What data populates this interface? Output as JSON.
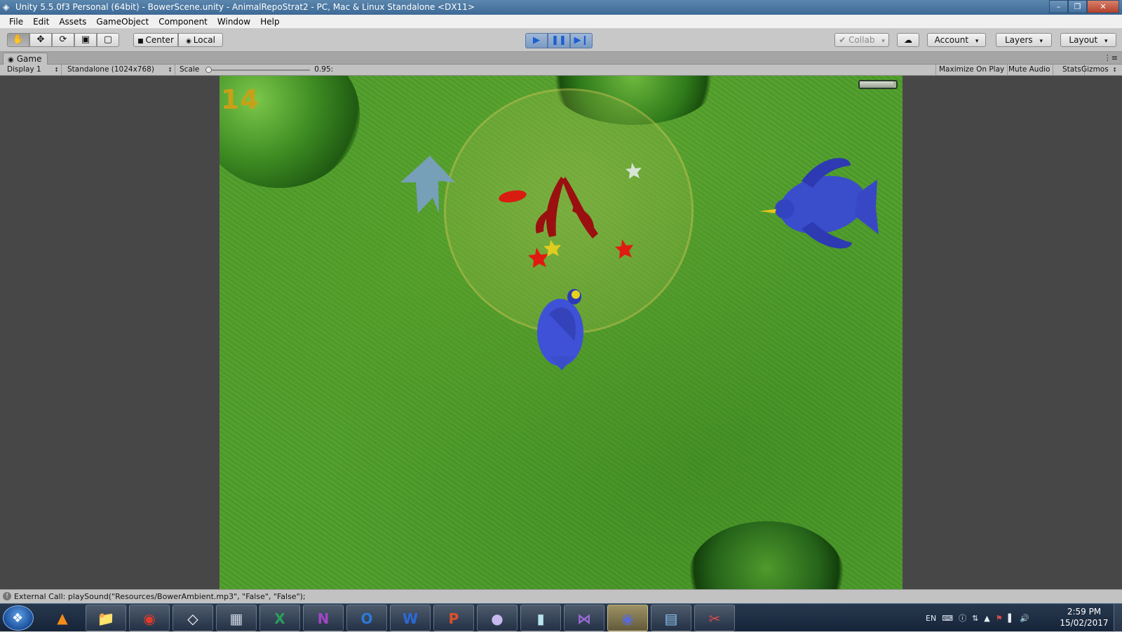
{
  "window": {
    "title": "Unity 5.5.0f3 Personal (64bit) - BowerScene.unity - AnimalRepoStrat2 - PC, Mac & Linux Standalone <DX11>",
    "buttons": {
      "minimize": "–",
      "restore": "❐",
      "close": "✕"
    }
  },
  "menu": [
    "File",
    "Edit",
    "Assets",
    "GameObject",
    "Component",
    "Window",
    "Help"
  ],
  "toolbar": {
    "transform_tools": [
      "hand-tool-icon",
      "move-tool-icon",
      "rotate-tool-icon",
      "scale-tool-icon",
      "rect-tool-icon"
    ],
    "pivot_center": "Center",
    "pivot_local": "Local",
    "play_icons": [
      "play-icon",
      "pause-icon",
      "step-icon"
    ],
    "collab": "Collab",
    "account": "Account",
    "layers": "Layers",
    "layout": "Layout"
  },
  "game_tab": {
    "label": "Game",
    "display": "Display 1",
    "resolution": "Standalone (1024x768)",
    "scale_label": "Scale",
    "scale_value": "0.95:",
    "maximize_on_play": "Maximize On Play",
    "mute_audio": "Mute Audio",
    "stats": "Stats",
    "gizmos": "Gizmos"
  },
  "game": {
    "score": "14",
    "health_fraction": 0.92
  },
  "status": {
    "message": "External Call: playSound(\"Resources/BowerAmbient.mp3\", \"False\", \"False\");"
  },
  "taskbar": {
    "apps": [
      "start-icon",
      "vlc-icon",
      "explorer-icon",
      "chrome-icon",
      "unity-icon",
      "calculator-icon",
      "excel-icon",
      "onenote-icon",
      "outlook-icon",
      "word-icon",
      "powerpoint-icon",
      "github-icon",
      "paper-icon",
      "visual-studio-icon",
      "discord-icon",
      "photo-viewer-icon",
      "snipping-tool-icon"
    ],
    "language": "EN",
    "time": "2:59 PM",
    "date": "15/02/2017"
  },
  "colors": {
    "grass": "#4e9d2a",
    "score": "#c8a018",
    "play_blue": "#1a5fd0",
    "editor_bg": "#474747"
  }
}
